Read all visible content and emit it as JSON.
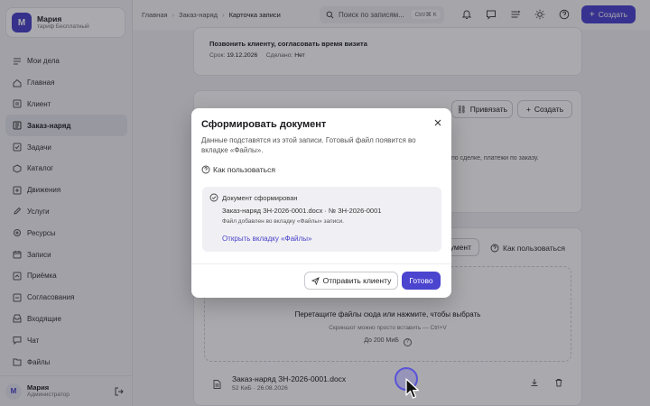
{
  "sidebar": {
    "profile": {
      "initial": "М",
      "name": "Мария",
      "plan": "тариф Бесплатный"
    },
    "items": [
      {
        "label": "Мои дела",
        "icon": "checklist-icon"
      },
      {
        "label": "Главная",
        "icon": "home-icon"
      },
      {
        "label": "Клиент",
        "icon": "client-icon"
      },
      {
        "label": "Заказ-наряд",
        "icon": "order-icon",
        "active": true
      },
      {
        "label": "Задачи",
        "icon": "tasks-icon"
      },
      {
        "label": "Каталог",
        "icon": "catalog-icon"
      },
      {
        "label": "Движения",
        "icon": "movements-icon"
      },
      {
        "label": "Услуги",
        "icon": "services-icon"
      },
      {
        "label": "Ресурсы",
        "icon": "resources-icon"
      },
      {
        "label": "Записи",
        "icon": "records-icon"
      },
      {
        "label": "Приёмка",
        "icon": "intake-icon"
      },
      {
        "label": "Согласования",
        "icon": "approvals-icon"
      },
      {
        "label": "Входящие",
        "icon": "inbox-icon"
      },
      {
        "label": "Чат",
        "icon": "chat-icon"
      },
      {
        "label": "Файлы",
        "icon": "files-icon"
      }
    ],
    "user": {
      "initial": "М",
      "name": "Мария",
      "role": "Администратор"
    }
  },
  "topbar": {
    "breadcrumbs": [
      "Главная",
      "Заказ-наряд",
      "Карточка записи"
    ],
    "search_placeholder": "Поиск по записям...",
    "search_shortcut": "Ctrl/⌘ K",
    "create_label": "Создать"
  },
  "task": {
    "title": "Позвонить клиенту, согласовать время визита",
    "due_label": "Срок:",
    "due_value": "19.12.2026",
    "done_label": "Сделано:",
    "done_value": "Нет"
  },
  "links_card": {
    "link_button": "Привязать",
    "create_button": "Создать",
    "hint": "по сделке, платежи по заказу."
  },
  "files_card": {
    "doc_button": "умент",
    "howto": "Как пользоваться",
    "dropzone_main": "Перетащите файлы сюда или нажмите, чтобы выбрать",
    "dropzone_sub": "Скриншот можно просто вставить — Ctrl+V",
    "dropzone_limit": "До 200 МиБ",
    "file": {
      "name": "Заказ-наряд ЗН-2026-0001.docx",
      "meta": "52 КиБ · 26.08.2026"
    }
  },
  "modal": {
    "title": "Сформировать документ",
    "description": "Данные подставятся из этой записи. Готовый файл появится во вкладке «Файлы».",
    "howto": "Как пользоваться",
    "result": {
      "status": "Документ сформирован",
      "file": "Заказ-наряд ЗН-2026-0001.docx · № ЗН-2026-0001",
      "note": "Файл добавлен во вкладку «Файлы» записи.",
      "link": "Открыть вкладку «Файлы»"
    },
    "send_button": "Отправить клиенту",
    "done_button": "Готово"
  },
  "colors": {
    "accent": "#4b44cf",
    "overlay": "rgba(20,20,30,0.36)"
  }
}
